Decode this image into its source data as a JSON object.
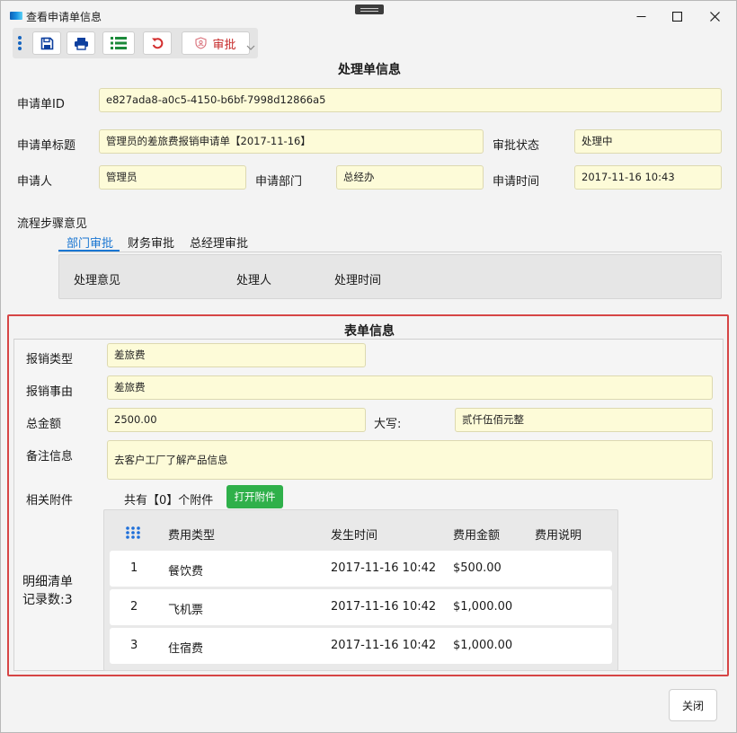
{
  "window": {
    "title": "查看申请单信息"
  },
  "toolbar": {
    "approve_label": "审批"
  },
  "colors": {
    "accent": "#1976d2",
    "approve_red": "#c62828",
    "attach_green": "#2fb04a",
    "field_bg": "#fdfbd8",
    "highlight_border": "#d64545"
  },
  "process": {
    "title": "处理单信息",
    "id_label": "申请单ID",
    "id_value": "e827ada8-a0c5-4150-b6bf-7998d12866a5",
    "subject_label": "申请单标题",
    "subject_value": "管理员的差旅费报销申请单【2017-11-16】",
    "status_label": "审批状态",
    "status_value": "处理中",
    "applicant_label": "申请人",
    "applicant_value": "管理员",
    "dept_label": "申请部门",
    "dept_value": "总经办",
    "time_label": "申请时间",
    "time_value": "2017-11-16 10:43"
  },
  "flow": {
    "label": "流程步骤意见",
    "tabs": [
      "部门审批",
      "财务审批",
      "总经理审批"
    ],
    "columns": [
      "处理意见",
      "处理人",
      "处理时间"
    ]
  },
  "form": {
    "title": "表单信息",
    "type_label": "报销类型",
    "type_value": "差旅费",
    "reason_label": "报销事由",
    "reason_value": "差旅费",
    "amount_label": "总金额",
    "amount_value": "2500.00",
    "upper_label": "大写:",
    "upper_value": "贰仟伍佰元整",
    "note_label": "备注信息",
    "note_value": "去客户工厂了解产品信息",
    "attach_label": "相关附件",
    "attach_count": "共有【0】个附件",
    "attach_button": "打开附件",
    "detail_label_1": "明细清单",
    "detail_label_2": "记录数:3",
    "detail_columns": [
      "费用类型",
      "发生时间",
      "费用金额",
      "费用说明"
    ],
    "detail_rows": [
      {
        "no": "1",
        "type": "餐饮费",
        "time": "2017-11-16 10:42",
        "amount": "$500.00",
        "desc": ""
      },
      {
        "no": "2",
        "type": "飞机票",
        "time": "2017-11-16 10:42",
        "amount": "$1,000.00",
        "desc": ""
      },
      {
        "no": "3",
        "type": "住宿费",
        "time": "2017-11-16 10:42",
        "amount": "$1,000.00",
        "desc": ""
      }
    ]
  },
  "footer": {
    "close_label": "关闭"
  }
}
